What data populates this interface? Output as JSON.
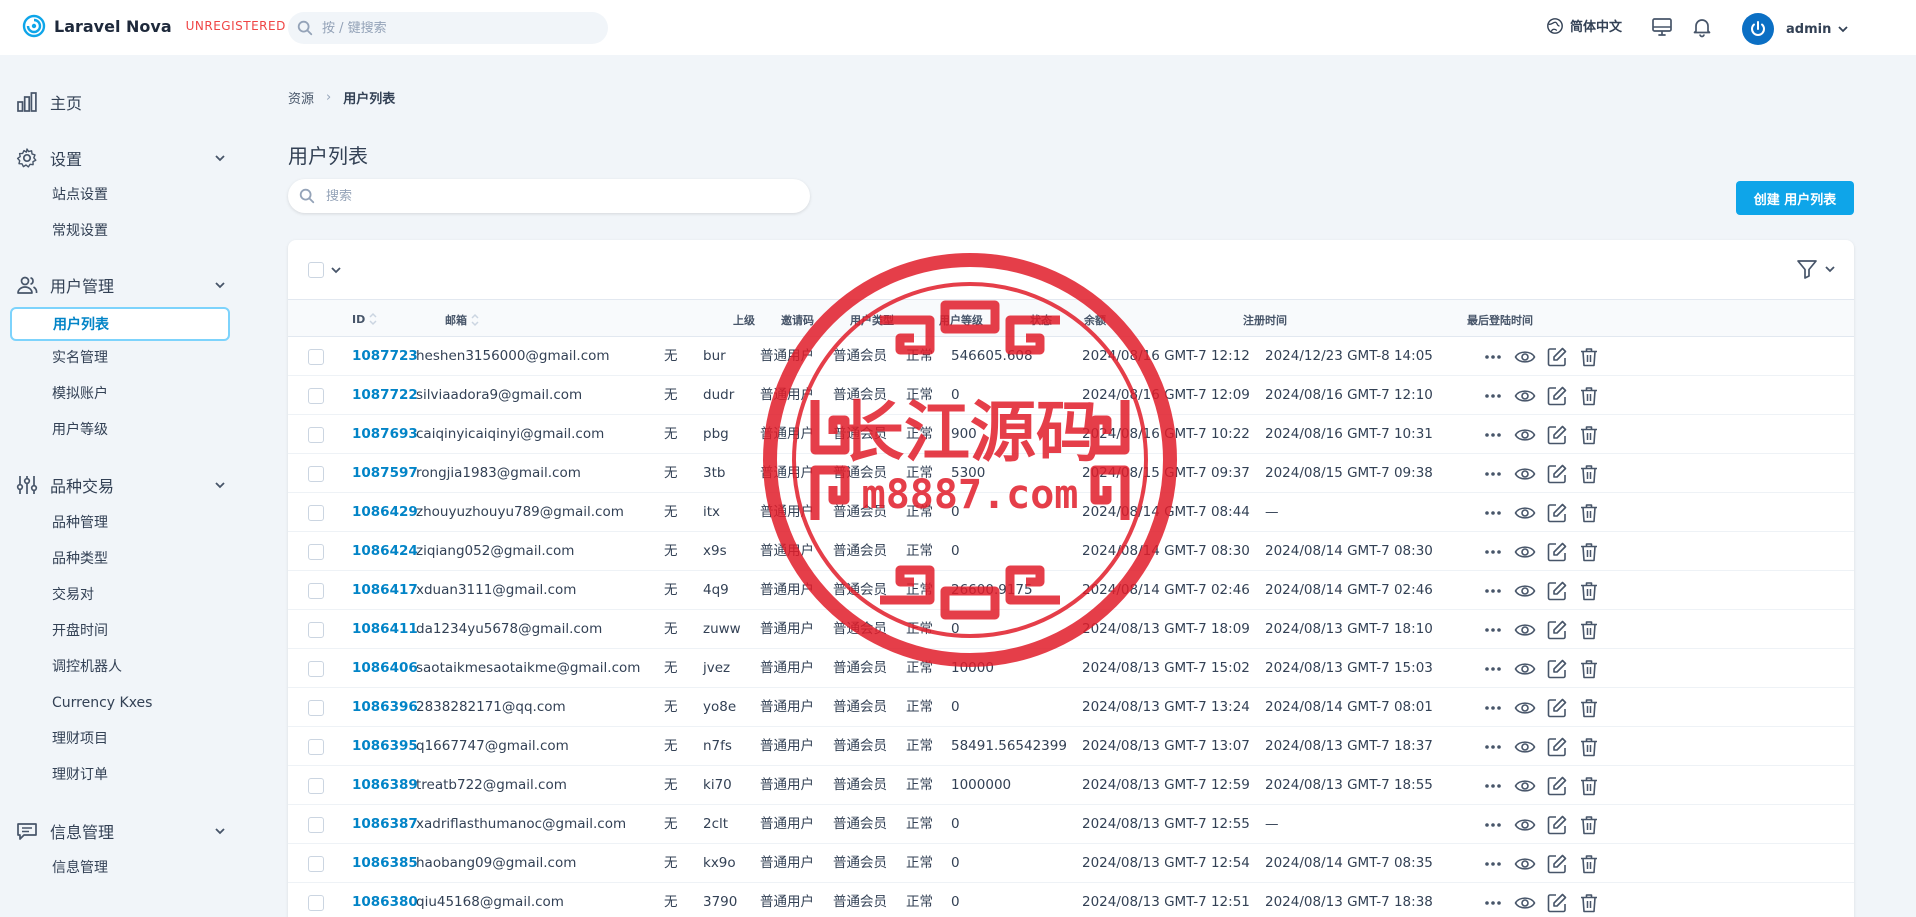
{
  "header": {
    "app_name": "Laravel Nova",
    "license_badge": "UNREGISTERED",
    "search_placeholder": "按 / 键搜索",
    "language": "简体中文",
    "user_name": "admin"
  },
  "sidebar": {
    "groups": [
      {
        "label": "主页",
        "items": []
      },
      {
        "label": "设置",
        "items": [
          "站点设置",
          "常规设置"
        ]
      },
      {
        "label": "用户管理",
        "items": [
          "用户列表",
          "实名管理",
          "模拟账户",
          "用户等级"
        ]
      },
      {
        "label": "品种交易",
        "items": [
          "品种管理",
          "品种类型",
          "交易对",
          "开盘时间",
          "调控机器人",
          "Currency Kxes",
          "理财项目",
          "理财订单"
        ]
      },
      {
        "label": "信息管理",
        "items": [
          "信息管理"
        ]
      }
    ],
    "active_item": "用户列表"
  },
  "breadcrumb": {
    "root": "资源",
    "current": "用户列表"
  },
  "page": {
    "title": "用户列表",
    "search_placeholder": "搜索",
    "create_label": "创建 用户列表"
  },
  "table": {
    "columns": [
      "ID",
      "邮箱",
      "上级",
      "邀请码",
      "用户类型",
      "用户等级",
      "状态",
      "余额",
      "注册时间",
      "最后登陆时间"
    ],
    "rows": [
      {
        "id": "1087723",
        "email": "heshen3156000@gmail.com",
        "parent": "无",
        "invite": "bur",
        "type": "普通用户",
        "level": "普通会员",
        "status": "正常",
        "balance": "546605.608",
        "registered": "2024/08/16 GMT-7 12:12",
        "last_login": "2024/12/23 GMT-8 14:05"
      },
      {
        "id": "1087722",
        "email": "silviaadora9@gmail.com",
        "parent": "无",
        "invite": "dudr",
        "type": "普通用户",
        "level": "普通会员",
        "status": "正常",
        "balance": "0",
        "registered": "2024/08/16 GMT-7 12:09",
        "last_login": "2024/08/16 GMT-7 12:10"
      },
      {
        "id": "1087693",
        "email": "caiqinyicaiqinyi@gmail.com",
        "parent": "无",
        "invite": "pbg",
        "type": "普通用户",
        "level": "普通会员",
        "status": "正常",
        "balance": "900",
        "registered": "2024/08/16 GMT-7 10:22",
        "last_login": "2024/08/16 GMT-7 10:31"
      },
      {
        "id": "1087597",
        "email": "rongjia1983@gmail.com",
        "parent": "无",
        "invite": "3tb",
        "type": "普通用户",
        "level": "普通会员",
        "status": "正常",
        "balance": "5300",
        "registered": "2024/08/15 GMT-7 09:37",
        "last_login": "2024/08/15 GMT-7 09:38"
      },
      {
        "id": "1086429",
        "email": "zhouyuzhouyu789@gmail.com",
        "parent": "无",
        "invite": "itx",
        "type": "普通用户",
        "level": "普通会员",
        "status": "正常",
        "balance": "0",
        "registered": "2024/08/14 GMT-7 08:44",
        "last_login": "—"
      },
      {
        "id": "1086424",
        "email": "ziqiang052@gmail.com",
        "parent": "无",
        "invite": "x9s",
        "type": "普通用户",
        "level": "普通会员",
        "status": "正常",
        "balance": "0",
        "registered": "2024/08/14 GMT-7 08:30",
        "last_login": "2024/08/14 GMT-7 08:30"
      },
      {
        "id": "1086417",
        "email": "xduan3111@gmail.com",
        "parent": "无",
        "invite": "4q9",
        "type": "普通用户",
        "level": "普通会员",
        "status": "正常",
        "balance": "26600.9175",
        "registered": "2024/08/14 GMT-7 02:46",
        "last_login": "2024/08/14 GMT-7 02:46"
      },
      {
        "id": "1086411",
        "email": "da1234yu5678@gmail.com",
        "parent": "无",
        "invite": "zuww",
        "type": "普通用户",
        "level": "普通会员",
        "status": "正常",
        "balance": "0",
        "registered": "2024/08/13 GMT-7 18:09",
        "last_login": "2024/08/13 GMT-7 18:10"
      },
      {
        "id": "1086406",
        "email": "saotaikmesaotaikme@gmail.com",
        "parent": "无",
        "invite": "jvez",
        "type": "普通用户",
        "level": "普通会员",
        "status": "正常",
        "balance": "10000",
        "registered": "2024/08/13 GMT-7 15:02",
        "last_login": "2024/08/13 GMT-7 15:03"
      },
      {
        "id": "1086396",
        "email": "2838282171@qq.com",
        "parent": "无",
        "invite": "yo8e",
        "type": "普通用户",
        "level": "普通会员",
        "status": "正常",
        "balance": "0",
        "registered": "2024/08/13 GMT-7 13:24",
        "last_login": "2024/08/14 GMT-7 08:01"
      },
      {
        "id": "1086395",
        "email": "q1667747@gmail.com",
        "parent": "无",
        "invite": "n7fs",
        "type": "普通用户",
        "level": "普通会员",
        "status": "正常",
        "balance": "58491.56542399",
        "registered": "2024/08/13 GMT-7 13:07",
        "last_login": "2024/08/13 GMT-7 18:37"
      },
      {
        "id": "1086389",
        "email": "treatb722@gmail.com",
        "parent": "无",
        "invite": "ki70",
        "type": "普通用户",
        "level": "普通会员",
        "status": "正常",
        "balance": "1000000",
        "registered": "2024/08/13 GMT-7 12:59",
        "last_login": "2024/08/13 GMT-7 18:55"
      },
      {
        "id": "1086387",
        "email": "xadriflasthumanoc@gmail.com",
        "parent": "无",
        "invite": "2clt",
        "type": "普通用户",
        "level": "普通会员",
        "status": "正常",
        "balance": "0",
        "registered": "2024/08/13 GMT-7 12:55",
        "last_login": "—"
      },
      {
        "id": "1086385",
        "email": "haobang09@gmail.com",
        "parent": "无",
        "invite": "kx9o",
        "type": "普通用户",
        "level": "普通会员",
        "status": "正常",
        "balance": "0",
        "registered": "2024/08/13 GMT-7 12:54",
        "last_login": "2024/08/14 GMT-7 08:35"
      },
      {
        "id": "1086380",
        "email": "qiu45168@gmail.com",
        "parent": "无",
        "invite": "3790",
        "type": "普通用户",
        "level": "普通会员",
        "status": "正常",
        "balance": "0",
        "registered": "2024/08/13 GMT-7 12:51",
        "last_login": "2024/08/13 GMT-7 18:38"
      }
    ]
  },
  "watermark": {
    "line1": "长江源码",
    "line2": "m8887.com"
  },
  "colors": {
    "accent": "#0ea5e9",
    "link": "#0284c7",
    "stamp": "#e11d2a",
    "badge": "#ef4444"
  }
}
